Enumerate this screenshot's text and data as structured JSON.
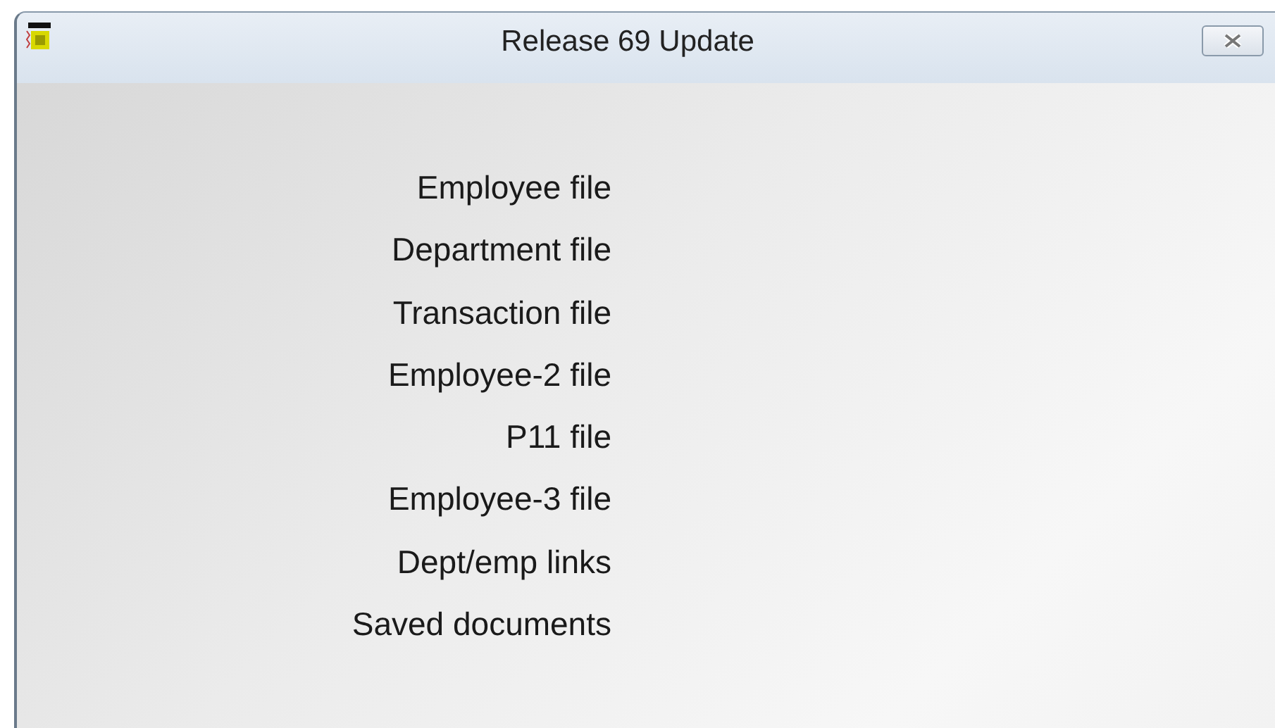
{
  "window": {
    "title": "Release 69 Update"
  },
  "items": [
    "Employee file",
    "Department file",
    "Transaction file",
    "Employee-2 file",
    "P11 file",
    "Employee-3 file",
    "Dept/emp links",
    "Saved documents"
  ]
}
